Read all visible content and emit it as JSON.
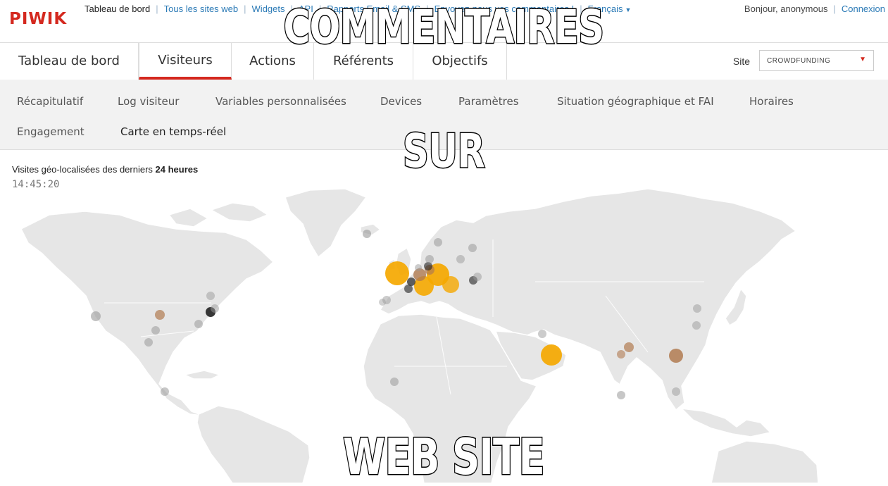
{
  "header": {
    "logo": "PIWIK",
    "links": [
      {
        "label": "Tableau de bord",
        "current": true
      },
      {
        "label": "Tous les sites web",
        "current": false
      },
      {
        "label": "Widgets",
        "current": false
      },
      {
        "label": "API",
        "current": false
      },
      {
        "label": "Rapports Email & SMS",
        "current": false
      },
      {
        "label": "Envoyez-nous vos commentaires !",
        "current": false
      },
      {
        "label": "Français",
        "current": false
      }
    ],
    "greeting": "Bonjour, anonymous",
    "login": "Connexion"
  },
  "main_nav": {
    "tabs": [
      "Tableau de bord",
      "Visiteurs",
      "Actions",
      "Référents",
      "Objectifs"
    ],
    "active": "Visiteurs",
    "site_label": "Site",
    "site_value": "CROWDFUNDING"
  },
  "sub_nav": {
    "row1": [
      "Récapitulatif",
      "Log visiteur",
      "Variables personnalisées",
      "Devices",
      "Paramètres",
      "Situation géographique et FAI",
      "Horaires"
    ],
    "row2": [
      "Engagement",
      "Carte en temps-réel"
    ],
    "current": "Carte en temps-réel"
  },
  "realtime_map": {
    "caption_prefix": "Visites géo-localisées des derniers",
    "caption_bold": "24 heures",
    "time": "14:45:20",
    "colors": {
      "land": "#e6e6e6",
      "border": "#ffffff",
      "recent": "#f5a800",
      "mid": "#b07a50",
      "old": "#999999",
      "dark": "#222222"
    }
  },
  "meme": {
    "top": "COMMENTAIRES",
    "middle": "SUR",
    "bottom": "WEB SITE"
  }
}
